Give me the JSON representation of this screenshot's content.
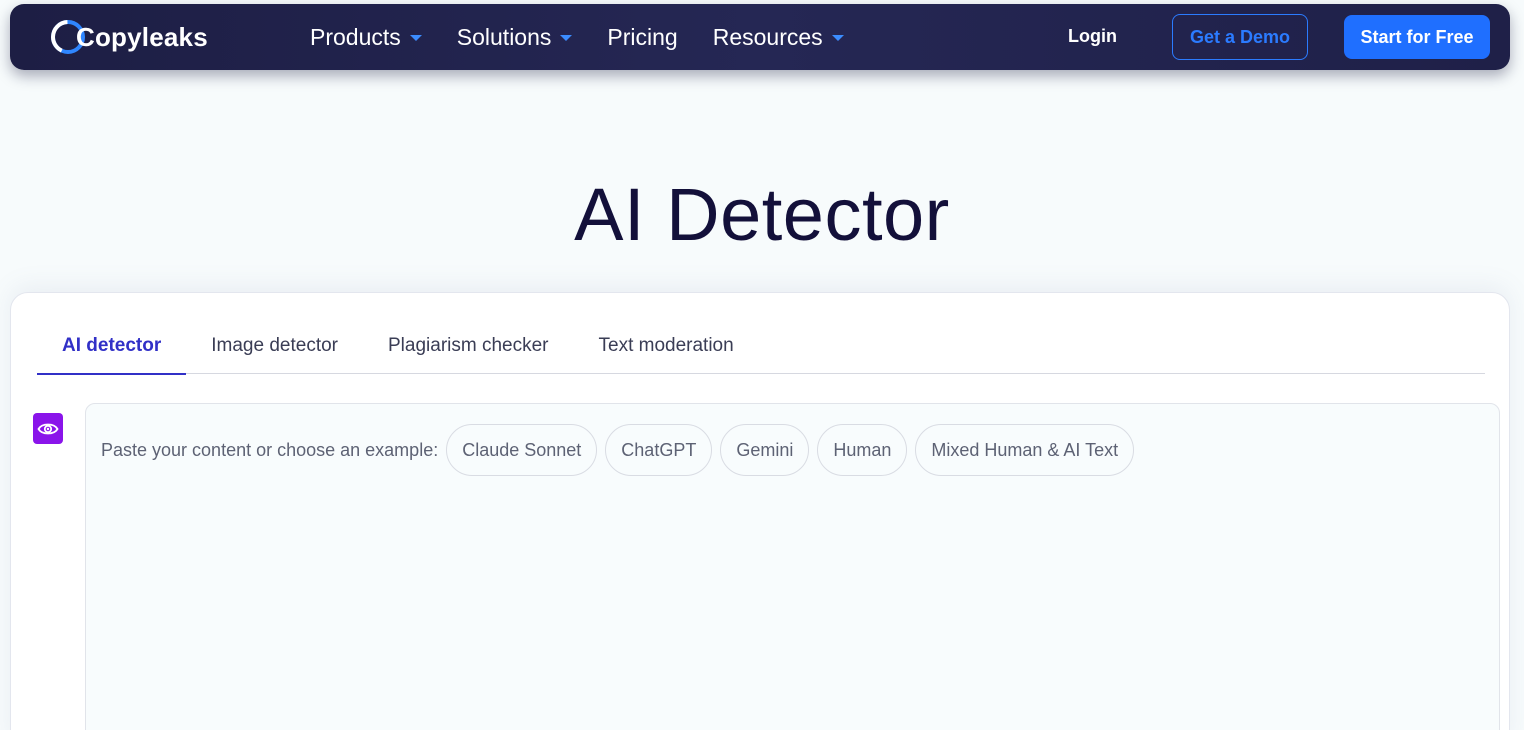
{
  "brand": {
    "name": "Copyleaks"
  },
  "nav": {
    "items": [
      {
        "label": "Products",
        "dropdown": true
      },
      {
        "label": "Solutions",
        "dropdown": true
      },
      {
        "label": "Pricing",
        "dropdown": false
      },
      {
        "label": "Resources",
        "dropdown": true
      }
    ],
    "login": "Login",
    "demo": "Get a Demo",
    "start": "Start for Free"
  },
  "hero": {
    "title": "AI Detector"
  },
  "tool": {
    "tabs": [
      {
        "label": "AI detector",
        "active": true
      },
      {
        "label": "Image detector",
        "active": false
      },
      {
        "label": "Plagiarism checker",
        "active": false
      },
      {
        "label": "Text moderation",
        "active": false
      }
    ],
    "side_icon": "eye-icon",
    "prompt": "Paste your content or choose an example:",
    "examples": [
      "Claude Sonnet",
      "ChatGPT",
      "Gemini",
      "Human",
      "Mixed Human & AI Text"
    ]
  },
  "colors": {
    "nav_bg": "#23244f",
    "accent_blue": "#1f6fff",
    "active_tab": "#3130c7",
    "title": "#13103a",
    "eye_purple": "#8a14ea"
  }
}
